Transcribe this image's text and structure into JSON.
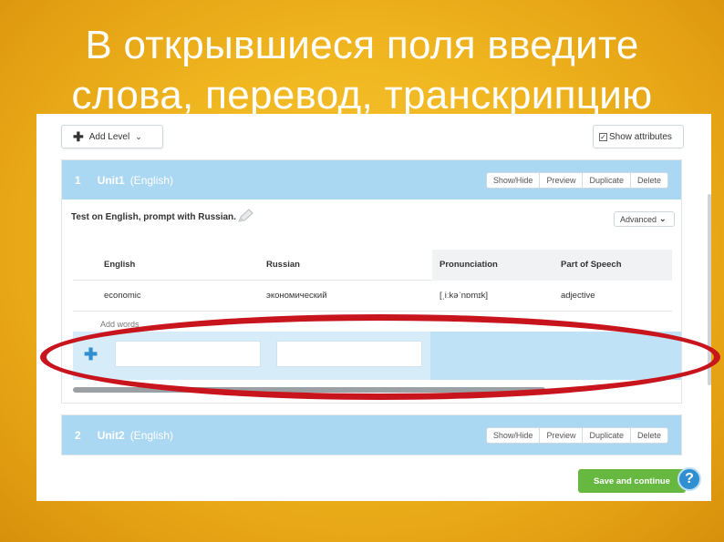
{
  "slide": {
    "title_line1": "В открывшиеся поля введите",
    "title_line2": "слова, перевод, транскрипцию"
  },
  "toolbar": {
    "add_level_label": "Add Level",
    "show_attributes_label": "Show attributes",
    "show_attributes_checked": true
  },
  "units": [
    {
      "number": "1",
      "name": "Unit1",
      "language": "(English)",
      "actions": [
        "Show/Hide",
        "Preview",
        "Duplicate",
        "Delete"
      ],
      "prompt": "Test on English, prompt with Russian.",
      "advanced_label": "Advanced",
      "columns": [
        "English",
        "Russian",
        "Pronunciation",
        "Part of Speech"
      ],
      "rows": [
        {
          "english": "economic",
          "russian": "экономический",
          "pronunciation": "[ˌiːkəˈnɒmɪk]",
          "part_of_speech": "adjective"
        }
      ],
      "add_words_label": "Add words"
    },
    {
      "number": "2",
      "name": "Unit2",
      "language": "(English)",
      "actions": [
        "Show/Hide",
        "Preview",
        "Duplicate",
        "Delete"
      ]
    }
  ],
  "footer": {
    "save_label": "Save and continue",
    "help_label": "?"
  },
  "colors": {
    "slide_bg": "#f0b620",
    "unit_header": "#aad7f2",
    "save_button": "#66b840",
    "highlight_oval": "#c8141c"
  }
}
